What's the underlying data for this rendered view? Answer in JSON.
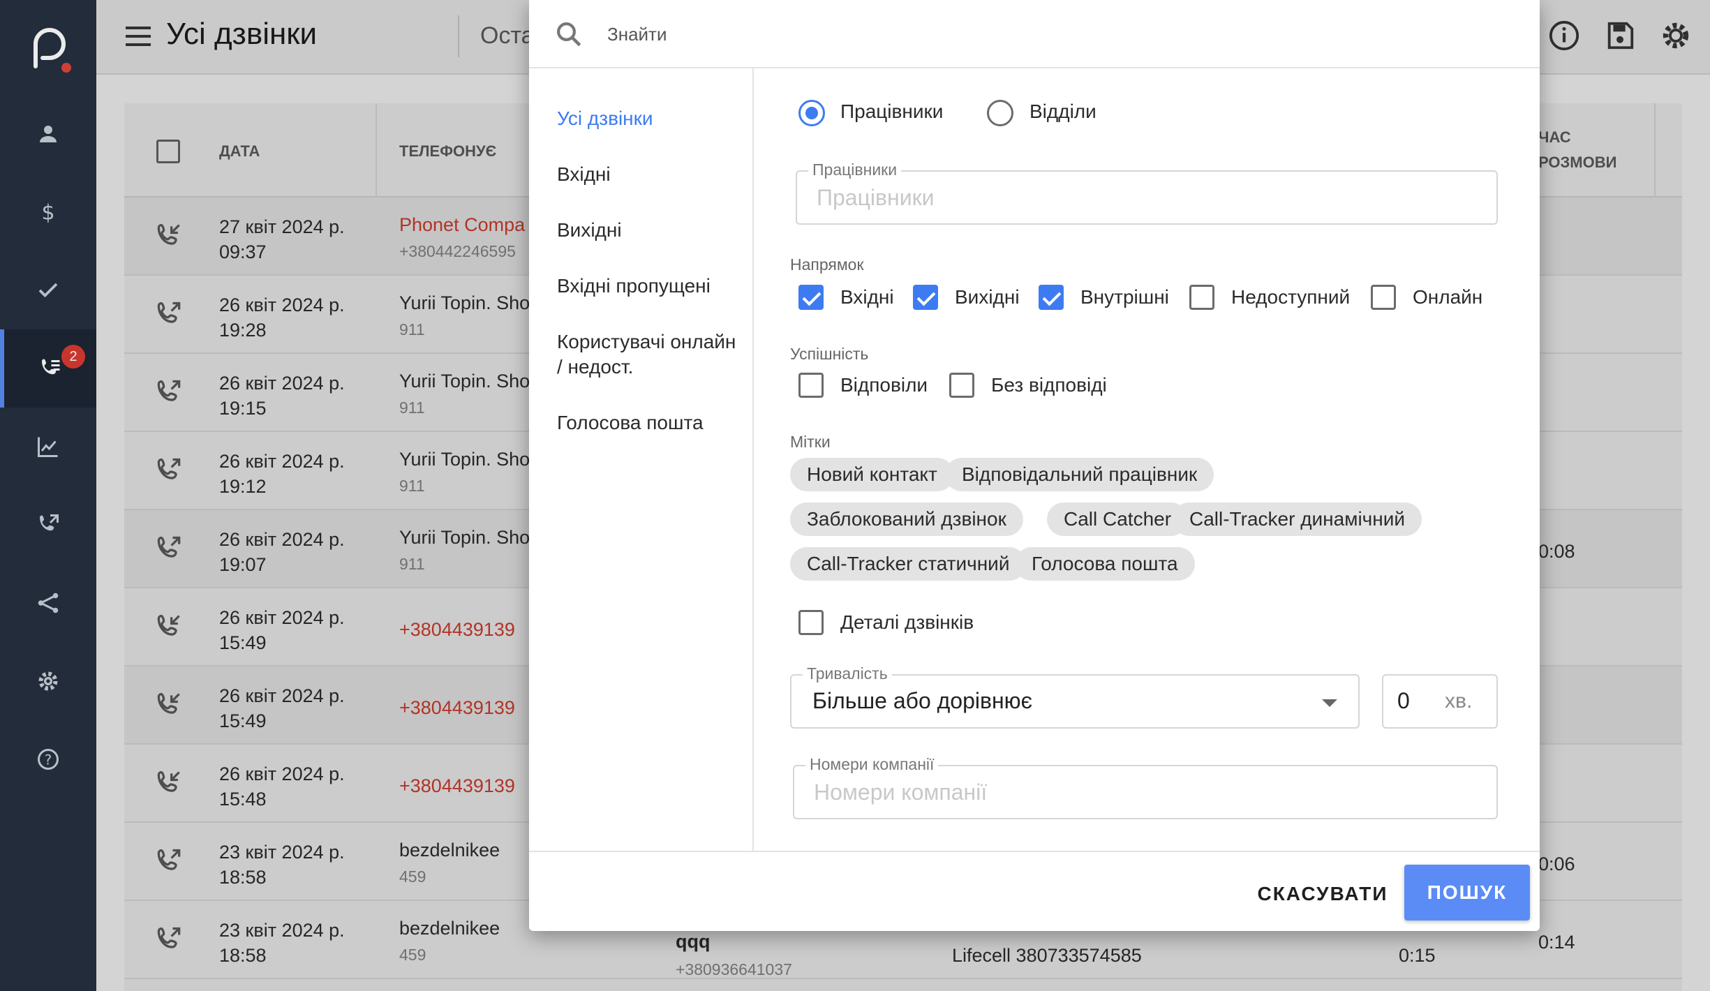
{
  "header": {
    "title": "Усі дзвінки",
    "tab_partial": "Оста"
  },
  "rail": {
    "badge_count": "2"
  },
  "table": {
    "columns": {
      "date": "ДАТА",
      "caller": "ТЕЛЕФОНУЄ",
      "talk_time_1": "ЧАС",
      "talk_time_2": "РОЗМОВИ"
    },
    "rows": [
      {
        "direction": "incoming",
        "date": "27 квіт 2024 р.",
        "time": "09:37",
        "name": "Phonet Compa",
        "name_red": true,
        "sub": "+380442246595",
        "talk": ""
      },
      {
        "direction": "outgoing",
        "date": "26 квіт 2024 р.",
        "time": "19:28",
        "name": "Yurii Topin. Sho",
        "name_red": false,
        "sub": "911",
        "talk": ""
      },
      {
        "direction": "outgoing",
        "date": "26 квіт 2024 р.",
        "time": "19:15",
        "name": "Yurii Topin. Sho",
        "name_red": false,
        "sub": "911",
        "talk": ""
      },
      {
        "direction": "outgoing",
        "date": "26 квіт 2024 р.",
        "time": "19:12",
        "name": "Yurii Topin. Sho",
        "name_red": false,
        "sub": "911",
        "talk": ""
      },
      {
        "direction": "outgoing",
        "date": "26 квіт 2024 р.",
        "time": "19:07",
        "name": "Yurii Topin. Sho",
        "name_red": false,
        "sub": "911",
        "talk": "0:08"
      },
      {
        "direction": "incoming",
        "date": "26 квіт 2024 р.",
        "time": "15:49",
        "name": "+3804439139",
        "name_red": true,
        "sub": "",
        "talk": ""
      },
      {
        "direction": "incoming",
        "date": "26 квіт 2024 р.",
        "time": "15:49",
        "name": "+3804439139",
        "name_red": true,
        "sub": "",
        "talk": ""
      },
      {
        "direction": "incoming",
        "date": "26 квіт 2024 р.",
        "time": "15:48",
        "name": "+3804439139",
        "name_red": true,
        "sub": "",
        "talk": ""
      },
      {
        "direction": "outgoing",
        "date": "23 квіт 2024 р.",
        "time": "18:58",
        "name": "bezdelnikee",
        "name_red": false,
        "sub": "459",
        "talk": "0:06"
      },
      {
        "direction": "outgoing",
        "date": "23 квіт 2024 р.",
        "time": "18:58",
        "name": "bezdelnikee",
        "name_red": false,
        "sub": "459",
        "talk": "0:14"
      }
    ],
    "last_row_extra": {
      "callee": "qqq",
      "callee_sub": "+380936641037",
      "line": "Lifecell 380733574585",
      "wait": "0:15"
    }
  },
  "dialog": {
    "search_placeholder": "Знайти",
    "nav": [
      "Усі дзвінки",
      "Вхідні",
      "Вихідні",
      "Вхідні пропущені",
      "Користувачі онлайн / недост.",
      "Голосова пошта"
    ],
    "radios": {
      "employees": "Працівники",
      "departments": "Відділи",
      "selected": "employees"
    },
    "employees_field": {
      "label": "Працівники",
      "placeholder": "Працівники"
    },
    "direction": {
      "title": "Напрямок",
      "items": [
        {
          "label": "Вхідні",
          "checked": true
        },
        {
          "label": "Вихідні",
          "checked": true
        },
        {
          "label": "Внутрішні",
          "checked": true
        },
        {
          "label": "Недоступний",
          "checked": false
        },
        {
          "label": "Онлайн",
          "checked": false
        }
      ]
    },
    "success": {
      "title": "Успішність",
      "items": [
        {
          "label": "Відповіли",
          "checked": false
        },
        {
          "label": "Без відповіді",
          "checked": false
        }
      ]
    },
    "tags": {
      "title": "Мітки",
      "items": [
        "Новий контакт",
        "Відповідальний працівник",
        "Заблокований дзвінок",
        "Call Catcher",
        "Call-Tracker динамічний",
        "Call-Tracker статичний",
        "Голосова пошта"
      ]
    },
    "details": {
      "label": "Деталі дзвінків",
      "checked": false
    },
    "duration": {
      "label": "Тривалість",
      "value": "Більше або дорівнює",
      "minutes": "0",
      "unit": "хв."
    },
    "company_numbers": {
      "label": "Номери компанії",
      "placeholder": "Номери компанії"
    },
    "buttons": {
      "cancel": "СКАСУВАТИ",
      "search": "ПОШУК"
    }
  },
  "colors": {
    "accent": "#3d7bf2",
    "button": "#5b8cf6",
    "rail": "#253040",
    "missed": "#c0392b"
  }
}
